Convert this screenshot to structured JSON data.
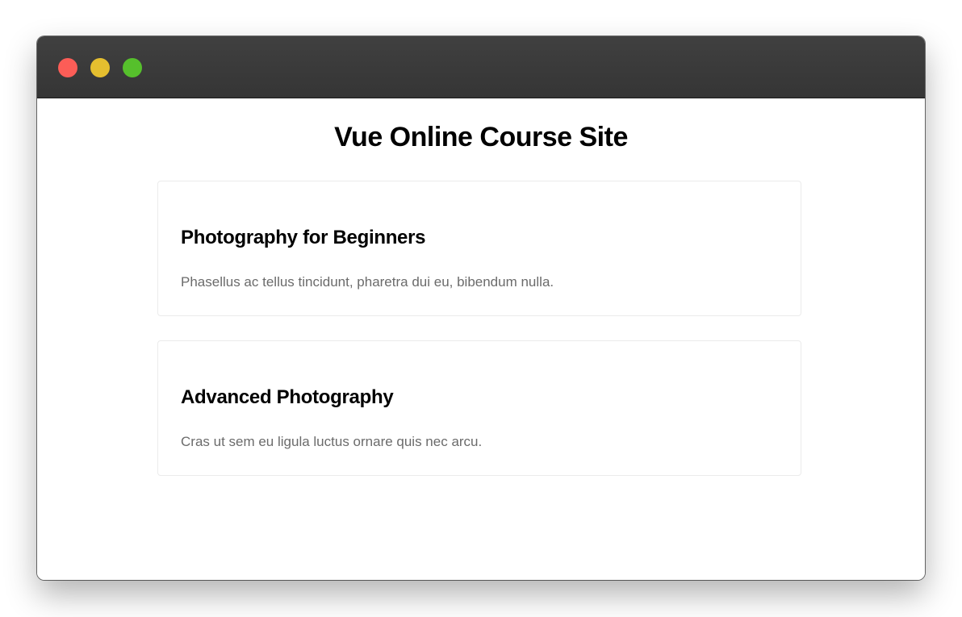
{
  "colors": {
    "titlebar": "#3a3a3a",
    "traffic_close": "#fc5d57",
    "traffic_minimize": "#e5bf2f",
    "traffic_zoom": "#56c02c",
    "card_border": "#ebebeb",
    "description_text": "#6b6b6b"
  },
  "window": {
    "controls": [
      "close-button",
      "minimize-button",
      "zoom-button"
    ]
  },
  "page": {
    "title": "Vue Online Course Site"
  },
  "courses": [
    {
      "title": "Photography for Beginners",
      "description": "Phasellus ac tellus tincidunt, pharetra dui eu, bibendum nulla."
    },
    {
      "title": "Advanced Photography",
      "description": "Cras ut sem eu ligula luctus ornare quis nec arcu."
    }
  ]
}
